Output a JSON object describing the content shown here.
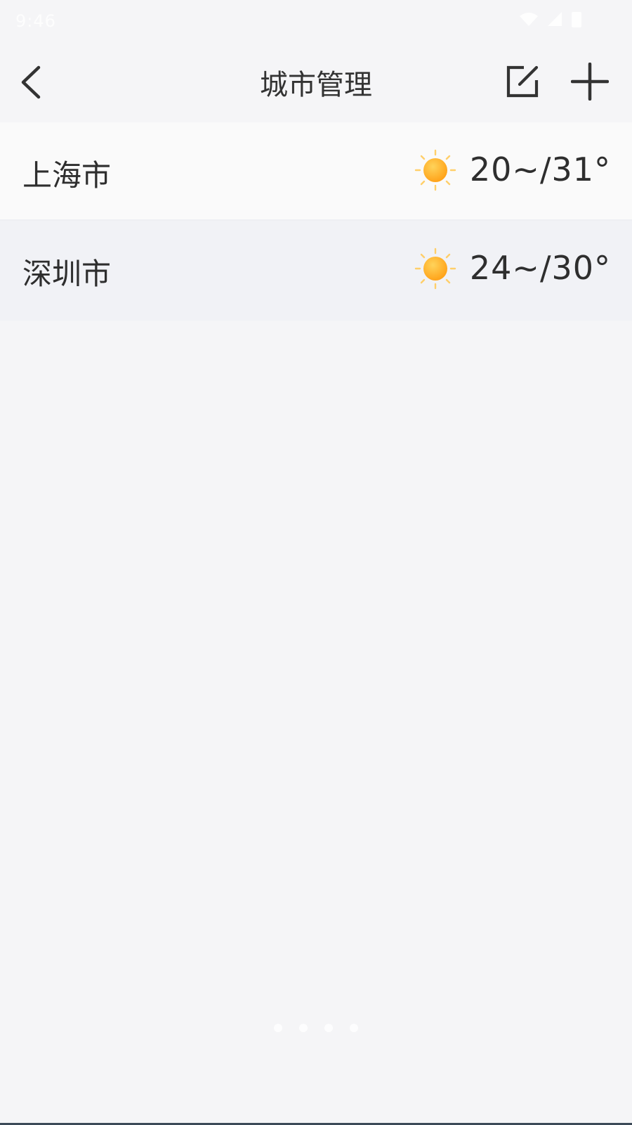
{
  "status_bar": {
    "time": "9:46"
  },
  "app_bar": {
    "title": "城市管理",
    "back_icon": "chevron-left-icon",
    "edit_icon": "edit-icon",
    "add_icon": "plus-icon"
  },
  "cities": [
    {
      "name": "上海市",
      "weather_icon": "sun-icon",
      "temp": "20~/31°"
    },
    {
      "name": "深圳市",
      "weather_icon": "sun-icon",
      "temp": "24~/30°"
    }
  ],
  "colors": {
    "background": "#f5f5f7",
    "sun_core": "#ffb020",
    "sun_rays": "#ffcf6a",
    "text": "#2e2e2e"
  }
}
